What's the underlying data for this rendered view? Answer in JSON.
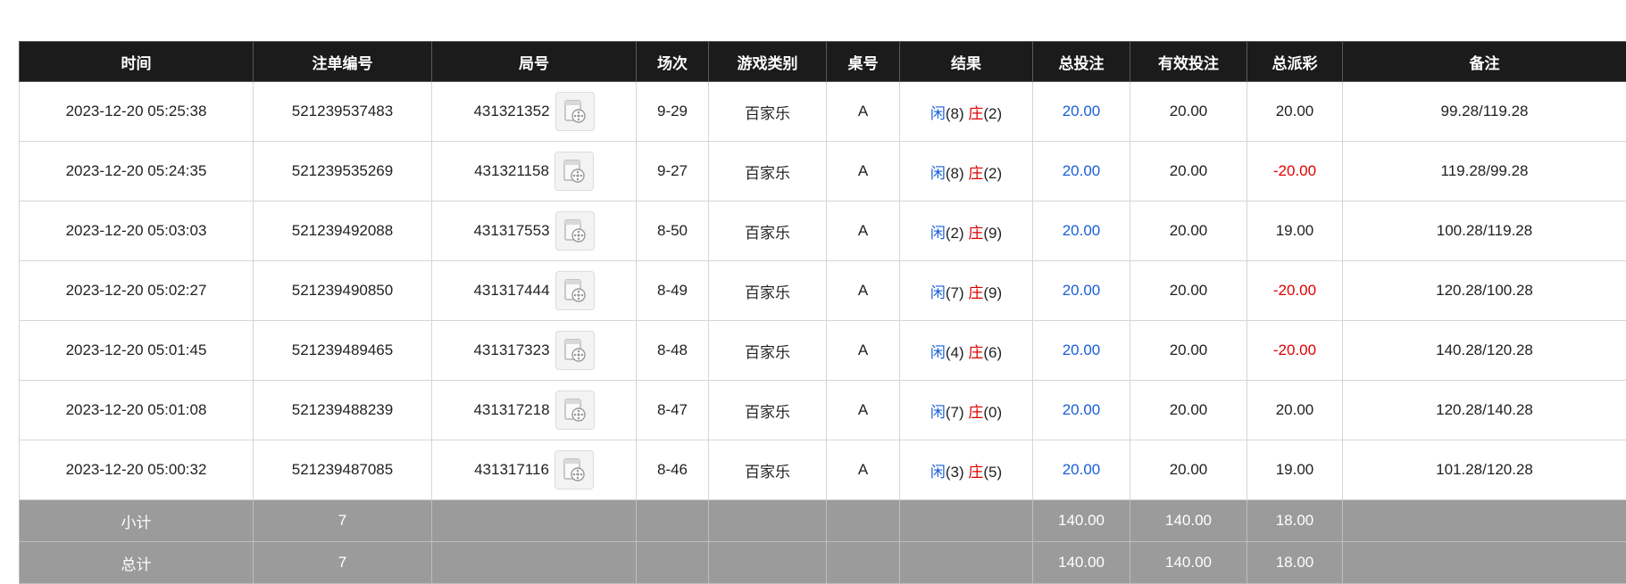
{
  "colors": {
    "header_bg": "#1b1b1b",
    "total_bg": "#9b9b9b",
    "blue": "#1a5fd6",
    "red": "#e00000"
  },
  "table": {
    "headers": [
      "时间",
      "注单编号",
      "局号",
      "场次",
      "游戏类别",
      "桌号",
      "结果",
      "总投注",
      "有效投注",
      "总派彩",
      "备注"
    ],
    "rows": [
      {
        "time": "2023-12-20 05:25:38",
        "order_no": "521239537483",
        "round_no": "431321352",
        "session": "9-29",
        "game": "百家乐",
        "table": "A",
        "player_label": "闲",
        "player_val": "(8)",
        "banker_label": "庄",
        "banker_val": "(2)",
        "total_bet": "20.00",
        "valid_bet": "20.00",
        "payout": "20.00",
        "payout_neg": false,
        "remark": "99.28/119.28"
      },
      {
        "time": "2023-12-20 05:24:35",
        "order_no": "521239535269",
        "round_no": "431321158",
        "session": "9-27",
        "game": "百家乐",
        "table": "A",
        "player_label": "闲",
        "player_val": "(8)",
        "banker_label": "庄",
        "banker_val": "(2)",
        "total_bet": "20.00",
        "valid_bet": "20.00",
        "payout": "-20.00",
        "payout_neg": true,
        "remark": "119.28/99.28"
      },
      {
        "time": "2023-12-20 05:03:03",
        "order_no": "521239492088",
        "round_no": "431317553",
        "session": "8-50",
        "game": "百家乐",
        "table": "A",
        "player_label": "闲",
        "player_val": "(2)",
        "banker_label": "庄",
        "banker_val": "(9)",
        "total_bet": "20.00",
        "valid_bet": "20.00",
        "payout": "19.00",
        "payout_neg": false,
        "remark": "100.28/119.28"
      },
      {
        "time": "2023-12-20 05:02:27",
        "order_no": "521239490850",
        "round_no": "431317444",
        "session": "8-49",
        "game": "百家乐",
        "table": "A",
        "player_label": "闲",
        "player_val": "(7)",
        "banker_label": "庄",
        "banker_val": "(9)",
        "total_bet": "20.00",
        "valid_bet": "20.00",
        "payout": "-20.00",
        "payout_neg": true,
        "remark": "120.28/100.28"
      },
      {
        "time": "2023-12-20 05:01:45",
        "order_no": "521239489465",
        "round_no": "431317323",
        "session": "8-48",
        "game": "百家乐",
        "table": "A",
        "player_label": "闲",
        "player_val": "(4)",
        "banker_label": "庄",
        "banker_val": "(6)",
        "total_bet": "20.00",
        "valid_bet": "20.00",
        "payout": "-20.00",
        "payout_neg": true,
        "remark": "140.28/120.28"
      },
      {
        "time": "2023-12-20 05:01:08",
        "order_no": "521239488239",
        "round_no": "431317218",
        "session": "8-47",
        "game": "百家乐",
        "table": "A",
        "player_label": "闲",
        "player_val": "(7)",
        "banker_label": "庄",
        "banker_val": "(0)",
        "total_bet": "20.00",
        "valid_bet": "20.00",
        "payout": "20.00",
        "payout_neg": false,
        "remark": "120.28/140.28"
      },
      {
        "time": "2023-12-20 05:00:32",
        "order_no": "521239487085",
        "round_no": "431317116",
        "session": "8-46",
        "game": "百家乐",
        "table": "A",
        "player_label": "闲",
        "player_val": "(3)",
        "banker_label": "庄",
        "banker_val": "(5)",
        "total_bet": "20.00",
        "valid_bet": "20.00",
        "payout": "19.00",
        "payout_neg": false,
        "remark": "101.28/120.28"
      }
    ],
    "subtotal": {
      "label": "小计",
      "count": "7",
      "total_bet": "140.00",
      "valid_bet": "140.00",
      "payout": "18.00"
    },
    "grandtotal": {
      "label": "总计",
      "count": "7",
      "total_bet": "140.00",
      "valid_bet": "140.00",
      "payout": "18.00"
    },
    "video_icon": "video-replay-icon"
  }
}
